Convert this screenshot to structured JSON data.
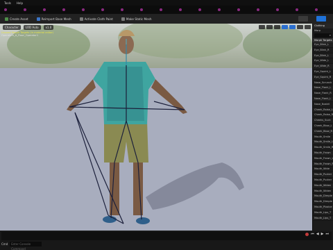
{
  "menu": {
    "items": [
      "Tools",
      "Help"
    ]
  },
  "toolbar": {
    "create_asset": "Create Asset",
    "reimport": "Reimport Base Mesh",
    "activate_cloth": "Activate Cloth Paint",
    "make_static": "Make Static Mesh"
  },
  "viewport": {
    "mode_label": "Character",
    "lod_label": "LOD Auto",
    "speed_label": "x1.0",
    "warning_line1": "Unused Morph Targets (in material editor)",
    "warning_line2": "Operators_A_Floor_Operator1"
  },
  "panel": {
    "title": "Clothing",
    "subtitle": "Morp",
    "header": "Morph Targets",
    "items": [
      "Eye_Blink_L",
      "Eye_Blink_R",
      "Eye_Blink_L",
      "Eye_Wide_L",
      "Eye_Wide_R",
      "Eye_Squint_L",
      "Eye_Squint_R",
      "Nose_Scrunch",
      "Nose_Flank_L",
      "Nose_Flank_R",
      "Nose_Flank_L",
      "Nose_Nostril",
      "Cheek_Raise_L",
      "Cheek_Raise_R",
      "Cheeks_Suck",
      "Cheek_Blow_L",
      "Cheek_Blow_R",
      "Mouth_Smile",
      "Mouth_Smile_L",
      "Mouth_Smile_R",
      "Mouth_Frown",
      "Mouth_Frown_L",
      "Mouth_Frown_R",
      "Mouth_Wide",
      "Mouth_Pucker",
      "Mouth_Pucker",
      "Mouth_Widen",
      "Mouth_Widen",
      "Mouth_Dimple",
      "Mouth_Dimple",
      "Mouth_Plosive",
      "Mouth_Lips_T",
      "Mouth_Lips_T"
    ]
  },
  "bottom": {
    "cmd_label": "Cmd",
    "cmd_placeholder": "Enter Console Command"
  }
}
